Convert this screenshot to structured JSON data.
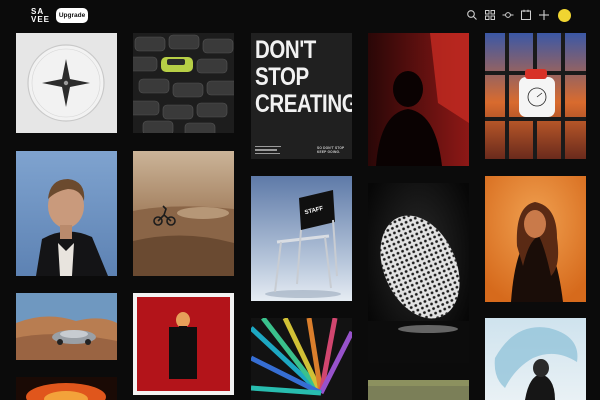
{
  "brand": {
    "logo_line1": "SA",
    "logo_line2": "VEE"
  },
  "header": {
    "upgrade_label": "Upgrade",
    "icons": [
      "search-icon",
      "grid-icon",
      "timeline-icon",
      "board-icon",
      "plus-icon",
      "avatar"
    ]
  },
  "colors": {
    "background": "#0b0b0b",
    "avatar": "#f0d531",
    "upgrade_bg": "#ffffff"
  },
  "posters": {
    "dont_stop": {
      "line1": "DON'T",
      "line2": "STOP",
      "line3": "CREATING",
      "footer_right_1": "SO DON'T STOP",
      "footer_right_2": "KEEP GOING."
    },
    "chair_sign": "STAFF"
  }
}
